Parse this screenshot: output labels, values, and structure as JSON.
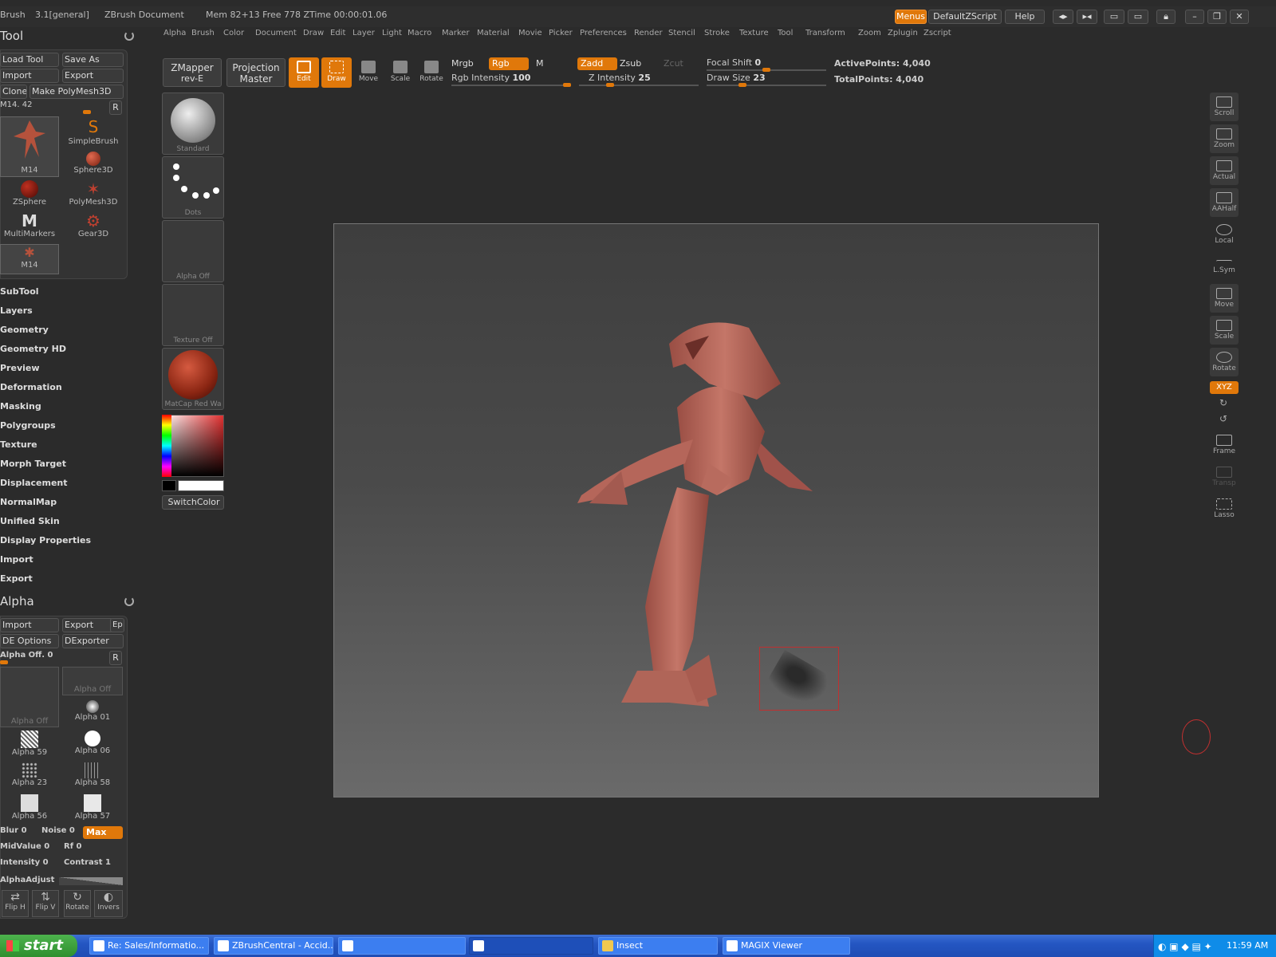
{
  "titlebar": {
    "brush": "Brush",
    "version": "3.1[general]",
    "doc": "ZBrush Document",
    "mem": "Mem 82+13 Free 778 ZTime 00:00:01.06",
    "menus_btn": "Menus",
    "script_btn": "DefaultZScript",
    "help_btn": "Help"
  },
  "menus": [
    "Alpha",
    "Brush",
    "Color",
    "Document",
    "Draw",
    "Edit",
    "Layer",
    "Light",
    "Macro",
    "Marker",
    "Material",
    "Movie",
    "Picker",
    "Preferences",
    "Render",
    "Stencil",
    "Stroke",
    "Texture",
    "Tool",
    "Transform",
    "Zoom",
    "Zplugin",
    "Zscript"
  ],
  "shelf": {
    "zmapper": "ZMapper",
    "zmapper_sub": "rev-E",
    "projection": "Projection",
    "projection_sub": "Master",
    "tools": [
      {
        "label": "Edit",
        "on": true
      },
      {
        "label": "Draw",
        "on": true
      },
      {
        "label": "Move",
        "on": false
      },
      {
        "label": "Scale",
        "on": false
      },
      {
        "label": "Rotate",
        "on": false
      }
    ],
    "mrgb": "Mrgb",
    "rgb": "Rgb",
    "m": "M",
    "rgb_intensity_label": "Rgb Intensity",
    "rgb_intensity": "100",
    "zadd": "Zadd",
    "zsub": "Zsub",
    "zcut": "Zcut",
    "z_intensity_label": "Z Intensity",
    "z_intensity": "25",
    "focal_shift_label": "Focal Shift",
    "focal_shift": "0",
    "draw_size_label": "Draw Size",
    "draw_size": "23",
    "active_points": "ActivePoints: 4,040",
    "total_points": "TotalPoints: 4,040"
  },
  "tool_panel": {
    "title": "Tool",
    "load_tool": "Load Tool",
    "save_as": "Save As",
    "import": "Import",
    "export": "Export",
    "clone": "Clone",
    "make_polymesh": "Make PolyMesh3D",
    "slider": "M14. 42",
    "r": "R",
    "items": [
      "M14",
      "SimpleBrush",
      "Sphere3D",
      "ZSphere",
      "PolyMesh3D",
      "MultiMarkers",
      "Gear3D",
      "M14"
    ],
    "sections": [
      "SubTool",
      "Layers",
      "Geometry",
      "Geometry HD",
      "Preview",
      "Deformation",
      "Masking",
      "Polygroups",
      "Texture",
      "Morph Target",
      "Displacement",
      "NormalMap",
      "Unified Skin",
      "Display Properties",
      "Import",
      "Export"
    ]
  },
  "alpha_panel": {
    "title": "Alpha",
    "import": "Import",
    "export": "Export",
    "ep": "Ep",
    "de_options": "DE Options",
    "dexporter": "DExporter",
    "alpha_off": "Alpha Off. 0",
    "r": "R",
    "items": [
      "Alpha Off",
      "Alpha Off",
      "Alpha 01",
      "Alpha 59",
      "Alpha 06",
      "Alpha 23",
      "Alpha 58",
      "Alpha 56",
      "Alpha 57"
    ],
    "blur": "Blur 0",
    "noise": "Noise 0",
    "max": "Max",
    "midvalue": "MidValue 0",
    "rf": "Rf 0",
    "intensity": "Intensity 0",
    "contrast": "Contrast 1",
    "alphaadjust": "AlphaAdjust",
    "bottom": [
      "Flip H",
      "Flip V",
      "Rotate",
      "Invers"
    ]
  },
  "column2": {
    "standard": "Standard",
    "dots": "Dots",
    "alpha_off": "Alpha Off",
    "texture_off": "Texture Off",
    "matcap": "MatCap Red Wa",
    "switchcolor": "SwitchColor"
  },
  "right_shelf": [
    "Scroll",
    "Zoom",
    "Actual",
    "AAHalf",
    "Local",
    "L.Sym",
    "Move",
    "Scale",
    "Rotate",
    "XYZ",
    "Frame",
    "Transp",
    "Lasso"
  ],
  "taskbar": {
    "start": "start",
    "tasks": [
      "Re: Sales/Informatio...",
      "ZBrushCentral - Accid...",
      "",
      "",
      "Insect",
      "MAGIX Viewer"
    ],
    "clock": "11:59 AM"
  },
  "colors": {
    "accent": "#e0780a",
    "bg": "#2b2b2b",
    "figure": "#b86a5e"
  }
}
